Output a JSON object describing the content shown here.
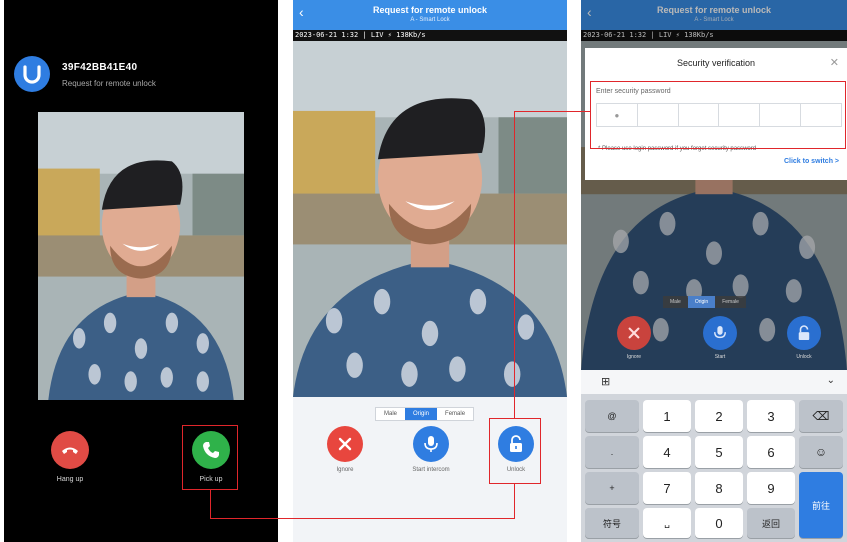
{
  "panel1": {
    "device_id": "39F42BB41E40",
    "subtitle": "Request for remote unlock",
    "hangup_label": "Hang up",
    "pickup_label": "Pick up"
  },
  "panel2": {
    "header_title": "Request for remote unlock",
    "header_subtitle": "A - Smart Lock",
    "osd_text": "2023-06-21 1:32 | LIV ⚡ 138Kb/s",
    "voice_modes": [
      "Male",
      "Origin",
      "Female"
    ],
    "active_voice_mode": "Origin",
    "ignore_label": "Ignore",
    "start_label": "Start intercom",
    "unlock_label": "Unlock"
  },
  "panel3": {
    "header_title": "Request for remote unlock",
    "header_subtitle": "A - Smart Lock",
    "osd_text": "2023-06-21 1:32 | LIV ⚡ 138Kb/s",
    "sheet_title": "Security verification",
    "password_label": "Enter security password",
    "hint": "* Please use login password if you forget security password",
    "switch_link": "Click to switch >",
    "voice_modes": [
      "Male",
      "Origin",
      "Female"
    ],
    "ignore_label": "Ignore",
    "start_label": "Start",
    "unlock_label": "Unlock",
    "keyboard": {
      "keys": [
        "1",
        "2",
        "3",
        "4",
        "5",
        "6",
        "7",
        "8",
        "9",
        "0"
      ],
      "symbols_key": "符号",
      "return_key": "返回",
      "go_key": "前往",
      "side_keys": [
        "@",
        ".",
        "+",
        "-"
      ]
    }
  },
  "colors": {
    "accent_blue": "#2f7de1",
    "pickup_green": "#2fb24a",
    "hangup_red": "#e04b45",
    "annotation_red": "#e0262b"
  }
}
